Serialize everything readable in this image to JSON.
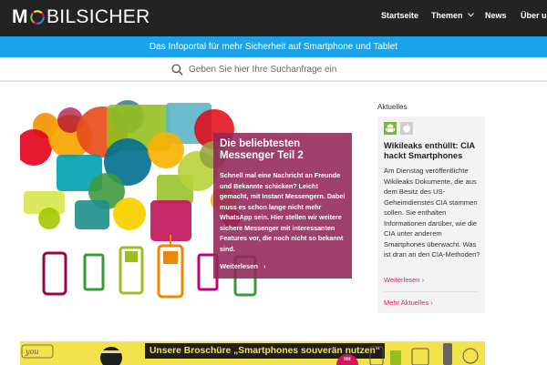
{
  "header": {
    "logo_first": "M",
    "logo_rest": "BILSICHER",
    "nav": [
      {
        "label": "Startseite"
      },
      {
        "label": "Themen"
      },
      {
        "label": "News"
      },
      {
        "label": "Über u"
      }
    ]
  },
  "banner": {
    "text": "Das Infoportal für mehr Sicherheit auf Smartphone und Tablet"
  },
  "search": {
    "placeholder": "Geben Sie hier Ihre Suchanfrage ein"
  },
  "hero": {
    "title": "Die beliebtesten Messenger Teil 2",
    "text": "Schnell mal eine Nachricht an Freunde und Bekannte schicken? Leicht gemacht, mit Instant Messengern. Dabei muss es schon lange nicht mehr WhatsApp sein. Hier stellen wir weitere sichere Messenger mit interessanten Features vor, die noch nicht so bekannt sind.",
    "more": "Weiterlesen"
  },
  "sidebar": {
    "heading": "Aktuelles",
    "icons": [
      "android-icon",
      "apple-icon"
    ],
    "title": "Wikileaks enthüllt: CIA hackt Smartphones",
    "text": "Am Dienstag veröffentlichte Wikileaks Dokumente, die aus dem Besitz des US-Geheimdienstes CIA stammen sollen. Sie enthalten Informationen darüber, wie die CIA unter anderem Smartphones überwacht. Was ist dran an den CIA-Methoden?",
    "more": "Weiterlesen",
    "all": "Mehr Aktuelles"
  },
  "promo": {
    "label": "Unsere Broschüre „Smartphones souverän nutzen“",
    "badge": "Hit"
  },
  "colors": {
    "topbar": "#232323",
    "banner": "#1aa3ea",
    "hero_card": "#912656",
    "link": "#e0245e",
    "promo": "#f2e34c"
  }
}
